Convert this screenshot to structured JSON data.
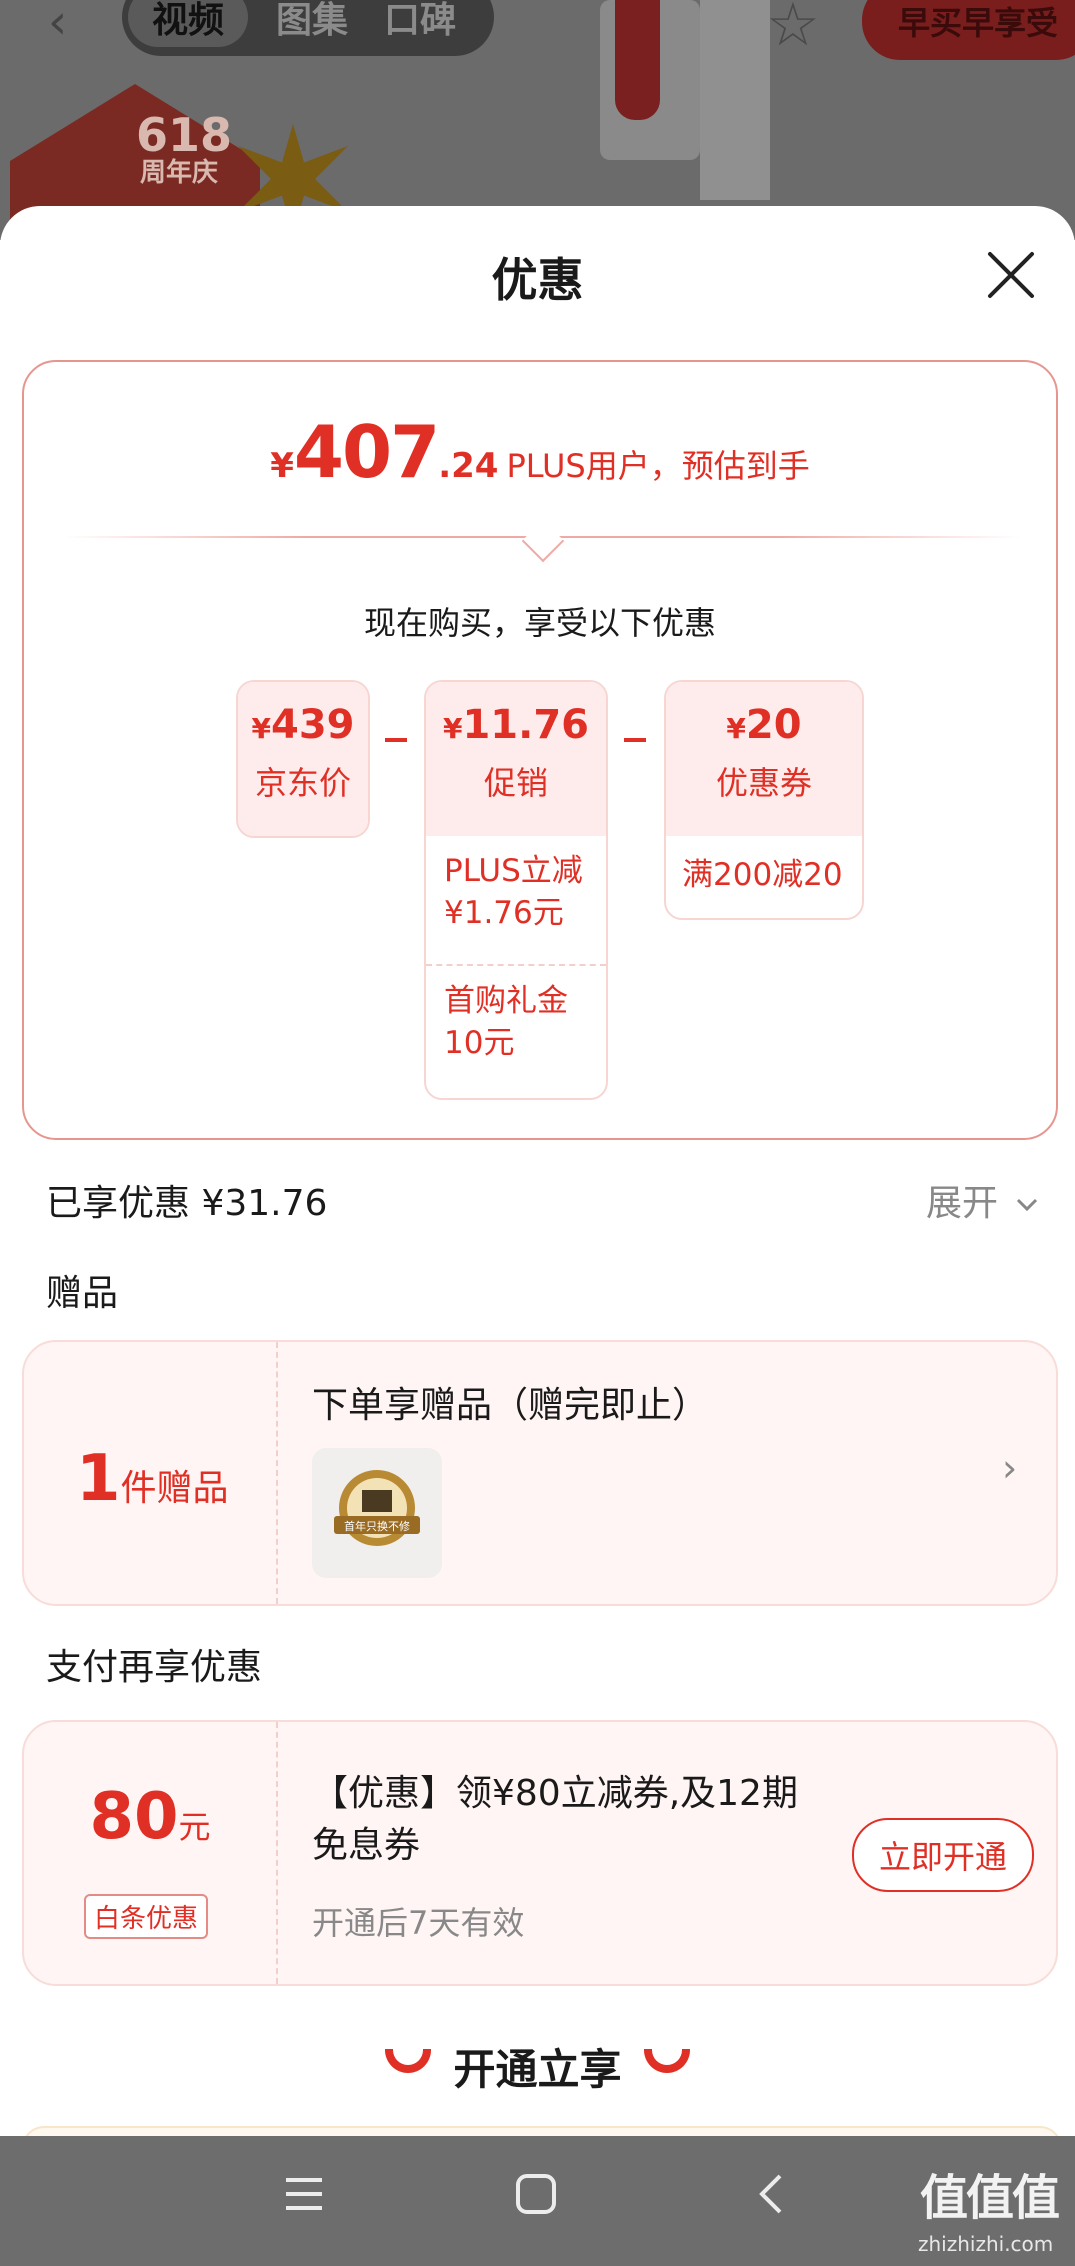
{
  "background": {
    "back_icon": "chevron-left-icon",
    "tabs": [
      {
        "label": "视频",
        "active": true
      },
      {
        "label": "图集",
        "active": false
      },
      {
        "label": "口碑",
        "active": false
      }
    ],
    "star_icon": "star-icon",
    "promo_button": "早买早享受",
    "badge": {
      "line1": "618",
      "line2": "周年庆"
    }
  },
  "sheet": {
    "title": "优惠",
    "close_icon": "close-icon"
  },
  "price": {
    "currency": "¥",
    "integer": "407",
    "decimal": ".24",
    "label": "PLUS用户，预估到手",
    "subtitle": "现在购买，享受以下优惠",
    "items": [
      {
        "currency": "¥",
        "amount": "439",
        "name": "京东价",
        "details": []
      },
      {
        "currency": "¥",
        "amount": "11.76",
        "name": "促销",
        "details": [
          "PLUS立减 ¥1.76元",
          "首购礼金 10元"
        ]
      },
      {
        "currency": "¥",
        "amount": "20",
        "name": "优惠券",
        "details": [
          "满200减20"
        ]
      }
    ]
  },
  "summary": {
    "saved": "已享优惠 ¥31.76",
    "expand": "展开"
  },
  "gift": {
    "title": "赠品",
    "count": "1",
    "count_unit": "件赠品",
    "text": "下单享赠品（赠完即止）",
    "thumb_text": "首年只换不修"
  },
  "payment": {
    "title": "支付再享优惠",
    "amount": "80",
    "unit": "元",
    "badge": "白条优惠",
    "text": "【优惠】领¥80立减券,及12期免息券",
    "note": "开通后7天有效",
    "button": "立即开通"
  },
  "open_now": "开通立享",
  "navbar": {
    "icons": [
      "menu-icon",
      "home-square-icon",
      "back-icon"
    ],
    "watermark": "值值值",
    "watermark_url": "zhizhizhi.com"
  },
  "colors": {
    "accent": "#e02f25",
    "card_bg": "#fff5f4",
    "chip_bg": "#fdeceb"
  }
}
